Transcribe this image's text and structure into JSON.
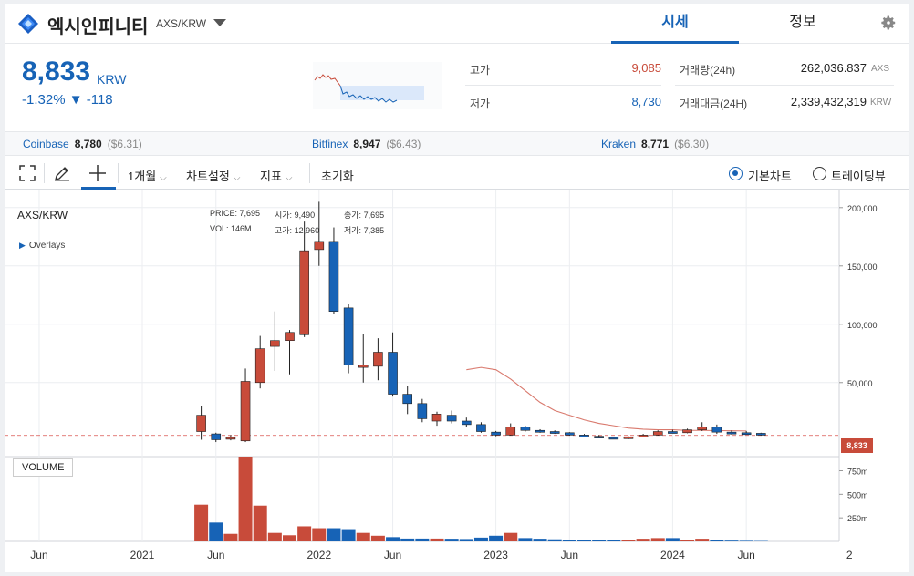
{
  "header": {
    "coin_name": "엑시인피니티",
    "pair": "AXS/KRW",
    "tabs": [
      "시세",
      "정보"
    ]
  },
  "price": {
    "current": "8,833",
    "unit": "KRW",
    "change_rate": "-1.32%",
    "change_amount": "▼ -118"
  },
  "stats": {
    "high_label": "고가",
    "high": "9,085",
    "low_label": "저가",
    "low": "8,730",
    "volume_label": "거래량(24h)",
    "volume": "262,036.837",
    "volume_unit": "AXS",
    "value_label": "거래대금(24H)",
    "value": "2,339,432,319",
    "value_unit": "KRW"
  },
  "exchanges": [
    {
      "name": "Coinbase",
      "price": "8,780",
      "usd": "($6.31)"
    },
    {
      "name": "Bitfinex",
      "price": "8,947",
      "usd": "($6.43)"
    },
    {
      "name": "Kraken",
      "price": "8,771",
      "usd": "($6.30)"
    }
  ],
  "toolbar": {
    "period": "1개월",
    "chart_settings": "차트설정",
    "indicators": "지표",
    "reset": "초기화",
    "basic_chart": "기본차트",
    "trading_view": "트레이딩뷰"
  },
  "colors": {
    "up": "#c84b3a",
    "down": "#1763b6",
    "accent": "#1763b6"
  },
  "chart_data": {
    "type": "candlestick",
    "pair_label": "AXS/KRW",
    "overlays_label": "Overlays",
    "volume_label": "VOLUME",
    "ohlc": {
      "price_label": "PRICE:",
      "price": "7,695",
      "open_label": "시가:",
      "open": "9,490",
      "close_label": "종가:",
      "close": "7,695",
      "vol_label": "VOL:",
      "vol": "146M",
      "high_label": "고가:",
      "high": "12,960",
      "low_label": "저가:",
      "low": "7,385"
    },
    "last_price_tag": "8,833",
    "y_ticks": [
      "200,000",
      "150,000",
      "100,000",
      "50,000"
    ],
    "y_values": [
      200000,
      150000,
      100000,
      50000
    ],
    "ylim": [
      -8000,
      210000
    ],
    "vol_ticks": [
      "750m",
      "500m",
      "250m"
    ],
    "vol_values": [
      750,
      500,
      250
    ],
    "vol_max": 900,
    "x_ticks": [
      "Jun",
      "2021",
      "Jun",
      "2022",
      "Jun",
      "2023",
      "Jun",
      "2024",
      "Jun",
      "2"
    ],
    "x_tick_months": [
      -7,
      0,
      5,
      12,
      17,
      24,
      29,
      36,
      41,
      48
    ],
    "candles": [
      {
        "m": 4,
        "o": 8000,
        "h": 30000,
        "l": 1000,
        "c": 22000,
        "v": 390
      },
      {
        "m": 5,
        "o": 6000,
        "h": 7000,
        "l": -1000,
        "c": 1000,
        "v": 200
      },
      {
        "m": 6,
        "o": 2000,
        "h": 5000,
        "l": 500,
        "c": 3000,
        "v": 80
      },
      {
        "m": 7,
        "o": 0,
        "h": 62000,
        "l": -1000,
        "c": 51000,
        "v": 900
      },
      {
        "m": 8,
        "o": 50000,
        "h": 90000,
        "l": 45000,
        "c": 79000,
        "v": 380
      },
      {
        "m": 9,
        "o": 81000,
        "h": 111000,
        "l": 60000,
        "c": 86000,
        "v": 90
      },
      {
        "m": 10,
        "o": 86000,
        "h": 95000,
        "l": 57000,
        "c": 93000,
        "v": 65
      },
      {
        "m": 11,
        "o": 91000,
        "h": 188000,
        "l": 89000,
        "c": 163000,
        "v": 160
      },
      {
        "m": 12,
        "o": 164000,
        "h": 205000,
        "l": 150000,
        "c": 171000,
        "v": 140
      },
      {
        "m": 13,
        "o": 171000,
        "h": 183000,
        "l": 109000,
        "c": 111000,
        "v": 140
      },
      {
        "m": 14,
        "o": 114000,
        "h": 117000,
        "l": 58000,
        "c": 65000,
        "v": 130
      },
      {
        "m": 15,
        "o": 63000,
        "h": 92000,
        "l": 50000,
        "c": 65000,
        "v": 90
      },
      {
        "m": 16,
        "o": 64000,
        "h": 88000,
        "l": 52000,
        "c": 76000,
        "v": 60
      },
      {
        "m": 17,
        "o": 76000,
        "h": 93000,
        "l": 38000,
        "c": 40000,
        "v": 45
      },
      {
        "m": 18,
        "o": 40000,
        "h": 47000,
        "l": 23000,
        "c": 32000,
        "v": 30
      },
      {
        "m": 19,
        "o": 32000,
        "h": 36000,
        "l": 16000,
        "c": 19000,
        "v": 30
      },
      {
        "m": 20,
        "o": 17000,
        "h": 25000,
        "l": 13000,
        "c": 23000,
        "v": 30
      },
      {
        "m": 21,
        "o": 22000,
        "h": 26000,
        "l": 15000,
        "c": 17000,
        "v": 28
      },
      {
        "m": 22,
        "o": 17000,
        "h": 20000,
        "l": 12000,
        "c": 14000,
        "v": 25
      },
      {
        "m": 23,
        "o": 14000,
        "h": 16000,
        "l": 7000,
        "c": 8000,
        "v": 40
      },
      {
        "m": 24,
        "o": 7500,
        "h": 8500,
        "l": 4000,
        "c": 5000,
        "v": 60
      },
      {
        "m": 25,
        "o": 5000,
        "h": 15000,
        "l": 4500,
        "c": 12000,
        "v": 90
      },
      {
        "m": 26,
        "o": 12000,
        "h": 13000,
        "l": 8000,
        "c": 9000,
        "v": 35
      },
      {
        "m": 27,
        "o": 9000,
        "h": 10000,
        "l": 7000,
        "c": 8000,
        "v": 28
      },
      {
        "m": 28,
        "o": 8000,
        "h": 9000,
        "l": 6000,
        "c": 7000,
        "v": 22
      },
      {
        "m": 29,
        "o": 7000,
        "h": 7500,
        "l": 4500,
        "c": 5000,
        "v": 18
      },
      {
        "m": 30,
        "o": 5000,
        "h": 6000,
        "l": 3500,
        "c": 4000,
        "v": 15
      },
      {
        "m": 31,
        "o": 4000,
        "h": 5000,
        "l": 2500,
        "c": 3000,
        "v": 15
      },
      {
        "m": 32,
        "o": 3000,
        "h": 3500,
        "l": 1500,
        "c": 2000,
        "v": 12
      },
      {
        "m": 33,
        "o": 2000,
        "h": 4000,
        "l": 1500,
        "c": 3500,
        "v": 14
      },
      {
        "m": 34,
        "o": 3500,
        "h": 6000,
        "l": 3000,
        "c": 5000,
        "v": 28
      },
      {
        "m": 35,
        "o": 5000,
        "h": 9000,
        "l": 4500,
        "c": 8000,
        "v": 35
      },
      {
        "m": 36,
        "o": 8000,
        "h": 9500,
        "l": 6500,
        "c": 7000,
        "v": 35
      },
      {
        "m": 37,
        "o": 7000,
        "h": 10500,
        "l": 6500,
        "c": 9500,
        "v": 18
      },
      {
        "m": 38,
        "o": 9500,
        "h": 16000,
        "l": 8500,
        "c": 12000,
        "v": 28
      },
      {
        "m": 39,
        "o": 12000,
        "h": 14000,
        "l": 6000,
        "c": 7500,
        "v": 12
      },
      {
        "m": 40,
        "o": 7500,
        "h": 9000,
        "l": 5500,
        "c": 7000,
        "v": 8
      },
      {
        "m": 41,
        "o": 7000,
        "h": 8500,
        "l": 5500,
        "c": 6500,
        "v": 6
      },
      {
        "m": 42,
        "o": 6500,
        "h": 7000,
        "l": 4500,
        "c": 5000,
        "v": 4
      }
    ],
    "ma_line": [
      [
        22,
        61000
      ],
      [
        23,
        63000
      ],
      [
        24,
        61000
      ],
      [
        25,
        53000
      ],
      [
        26,
        43000
      ],
      [
        27,
        33000
      ],
      [
        28,
        26000
      ],
      [
        29,
        22000
      ],
      [
        30,
        18000
      ],
      [
        31,
        15000
      ],
      [
        32,
        13000
      ],
      [
        33,
        11000
      ],
      [
        34,
        10000
      ],
      [
        35,
        9500
      ],
      [
        36,
        9500
      ],
      [
        37,
        9000
      ],
      [
        38,
        9000
      ],
      [
        39,
        8800
      ],
      [
        40,
        8700
      ],
      [
        41,
        8500
      ]
    ]
  }
}
